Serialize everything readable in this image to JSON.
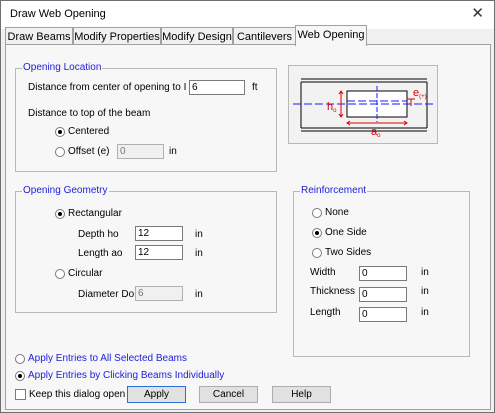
{
  "window": {
    "title": "Draw Web Opening",
    "close_glyph": "✕"
  },
  "tabs": [
    {
      "label": "Draw Beams"
    },
    {
      "label": "Modify Properties"
    },
    {
      "label": "Modify Design"
    },
    {
      "label": "Cantilevers"
    },
    {
      "label": "Web Opening",
      "active": true
    }
  ],
  "location": {
    "title": "Opening Location",
    "distance_label": "Distance from center of opening to I end",
    "distance_value": "6",
    "distance_unit": "ft",
    "top_label": "Distance to top of the beam",
    "centered_label": "Centered",
    "centered_selected": true,
    "offset_label": "Offset (e)",
    "offset_value": "0",
    "offset_unit": "in"
  },
  "sketch": {
    "h_label": "h",
    "h_sub": "o",
    "a_label": "a",
    "a_sub": "o",
    "e_label": "e",
    "e_sub": "(+)",
    "beam_color": "#1a1aff",
    "dim_color": "#dd0000"
  },
  "geometry": {
    "title": "Opening Geometry",
    "rect_label": "Rectangular",
    "rect_selected": true,
    "depth_label": "Depth ho",
    "depth_value": "12",
    "depth_unit": "in",
    "length_label": "Length ao",
    "length_value": "12",
    "length_unit": "in",
    "circ_label": "Circular",
    "diam_label": "Diameter Do",
    "diam_value": "6",
    "diam_unit": "in"
  },
  "reinforcement": {
    "title": "Reinforcement",
    "none_label": "None",
    "one_label": "One Side",
    "two_label": "Two Sides",
    "selected": "One Side",
    "width_label": "Width",
    "width_value": "0",
    "width_unit": "in",
    "thick_label": "Thickness",
    "thick_value": "0",
    "thick_unit": "in",
    "length_label": "Length",
    "length_value": "0",
    "length_unit": "in"
  },
  "apply_mode": {
    "all_label": "Apply Entries to All Selected Beams",
    "click_label": "Apply Entries by Clicking Beams Individually",
    "selected": "click"
  },
  "footer": {
    "keep_label": "Keep this dialog open",
    "keep_checked": false,
    "apply_label": "Apply",
    "cancel_label": "Cancel",
    "help_label": "Help"
  }
}
